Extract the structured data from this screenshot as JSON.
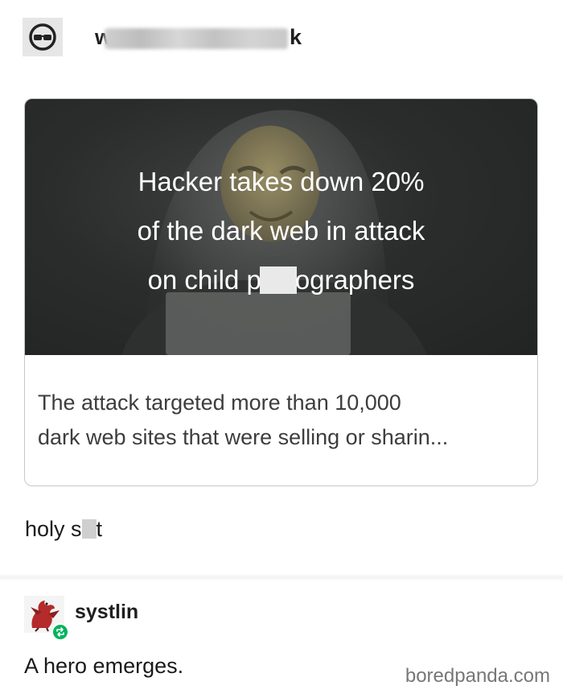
{
  "post": {
    "username_start": "w",
    "username_end": "k",
    "card": {
      "headline_lines": [
        "Hacker takes down 20%",
        "of the dark web in attack"
      ],
      "headline_line3_start": "on child p",
      "headline_line3_end": "ographers",
      "excerpt_lines": [
        "The attack targeted more than 10,000",
        "dark web sites that were selling or sharin..."
      ]
    },
    "comment_start": "holy s",
    "comment_end": "t"
  },
  "reblog": {
    "username": "systlin",
    "text": "A hero emerges."
  },
  "watermark": "boredpanda.com",
  "icons": {
    "poster_avatar": "sunglasses-avatar-icon",
    "reblog_avatar": "dragon-avatar-icon",
    "reblog_badge": "reblog-icon"
  },
  "colors": {
    "card_image_bg": "#2b2d2d",
    "reblog_badge": "#00b35c"
  }
}
